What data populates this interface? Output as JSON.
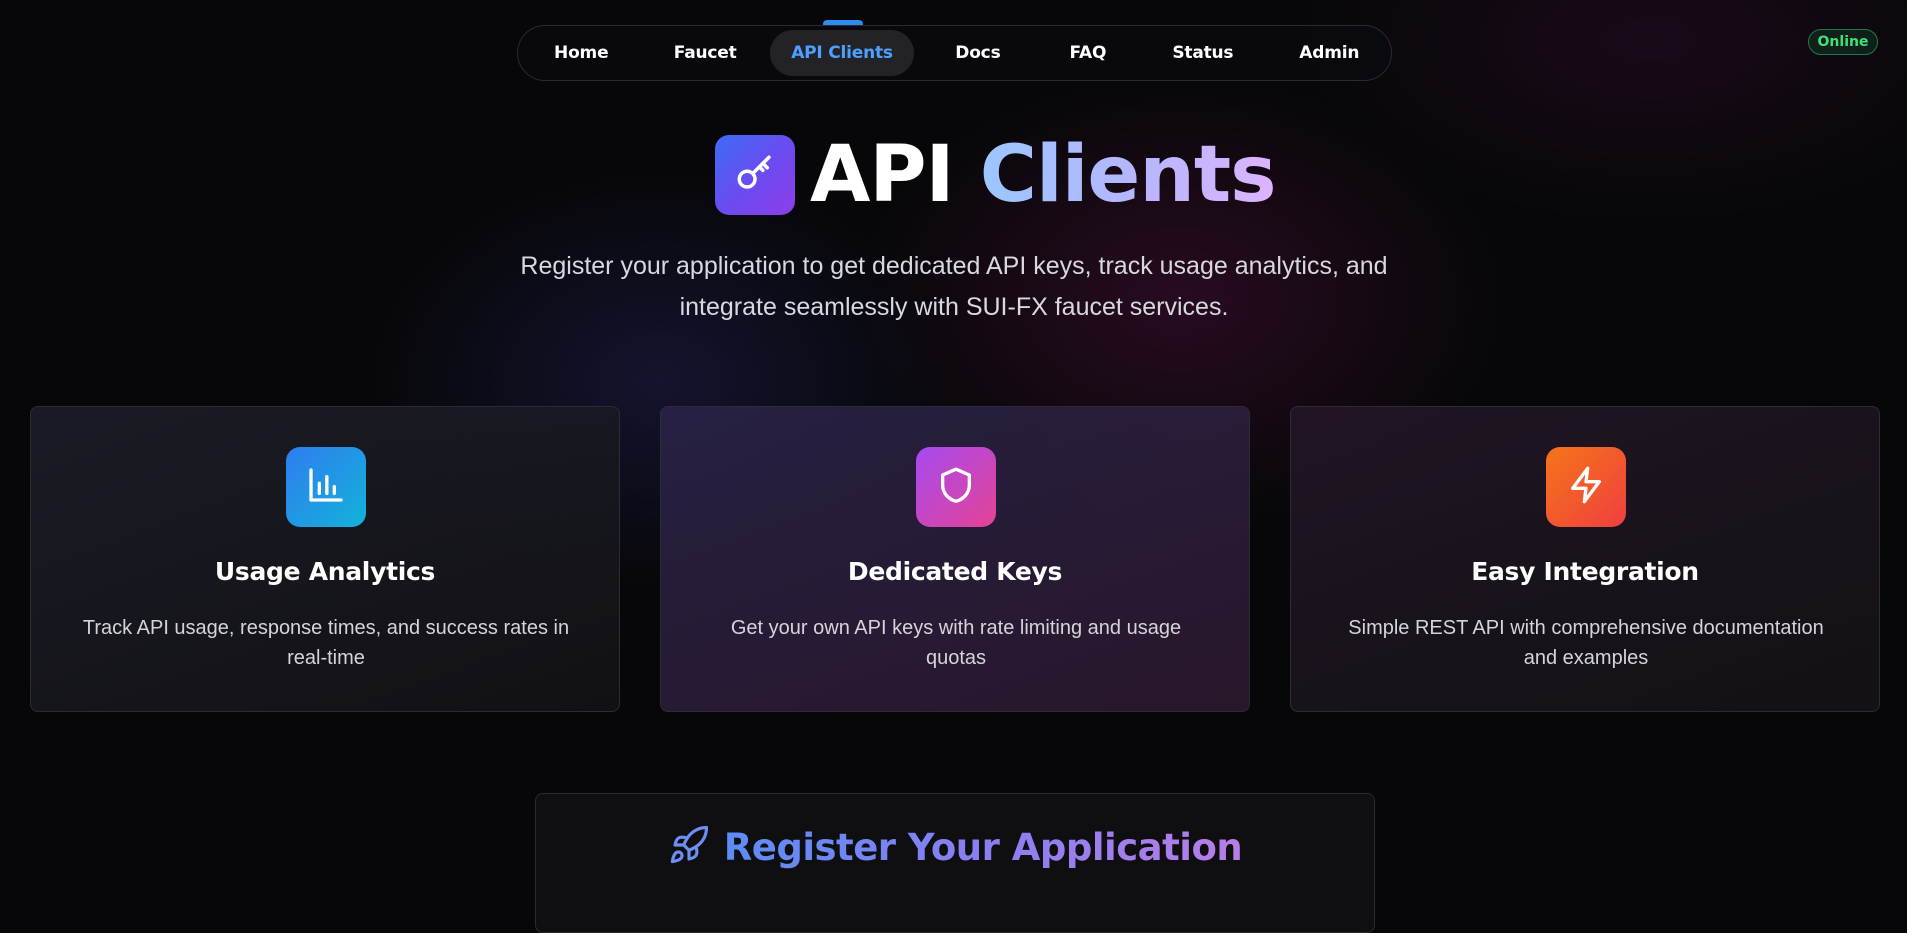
{
  "nav": {
    "items": [
      {
        "label": "Home",
        "width": 119
      },
      {
        "label": "Faucet",
        "width": 130
      },
      {
        "label": "API Clients",
        "width": 145,
        "active": true
      },
      {
        "label": "Docs",
        "width": 128
      },
      {
        "label": "FAQ",
        "width": 93
      },
      {
        "label": "Status",
        "width": 138
      },
      {
        "label": "Admin",
        "width": 116
      }
    ]
  },
  "status": {
    "label": "Online",
    "color": "#3ee07a"
  },
  "hero": {
    "title_part1": "API",
    "title_part2": "Clients",
    "icon": "key-icon",
    "subtitle": "Register your application to get dedicated API keys, track usage analytics, and integrate seamlessly with SUI-FX faucet services."
  },
  "features": [
    {
      "icon": "bar-chart-icon",
      "title": "Usage Analytics",
      "description": "Track API usage, response times, and success rates in real-time"
    },
    {
      "icon": "shield-icon",
      "title": "Dedicated Keys",
      "description": "Get your own API keys with rate limiting and usage quotas"
    },
    {
      "icon": "lightning-icon",
      "title": "Easy Integration",
      "description": "Simple REST API with comprehensive documentation and examples"
    }
  ],
  "register": {
    "icon": "rocket-icon",
    "title": "Register Your Application"
  },
  "colors": {
    "accent": "#2d8cf0",
    "background": "#070709"
  }
}
